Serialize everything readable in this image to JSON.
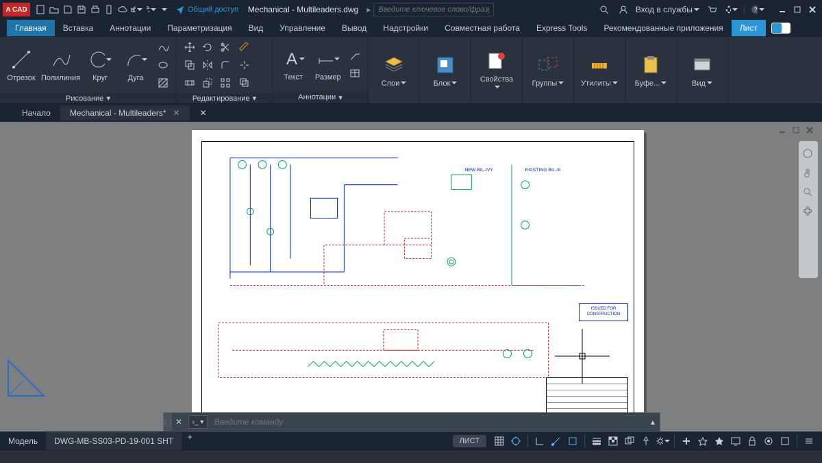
{
  "app": {
    "badge": "A CAD",
    "title": "Mechanical - Multileaders.dwg",
    "share": "Общий доступ"
  },
  "qat_icons": [
    "new",
    "open",
    "save",
    "saveas",
    "plot",
    "mobile",
    "undo",
    "redo"
  ],
  "search": {
    "placeholder": "Введите ключевое слово/фразу"
  },
  "login": "Вход в службы",
  "ribbon_tabs": [
    "Главная",
    "Вставка",
    "Аннотации",
    "Параметризация",
    "Вид",
    "Управление",
    "Вывод",
    "Надстройки",
    "Совместная работа",
    "Express Tools",
    "Рекомендованные приложения",
    "Лист"
  ],
  "ribbon_active": 0,
  "ribbon_accent": 11,
  "panels": {
    "draw": {
      "title": "Рисование",
      "items": [
        "Отрезок",
        "Полилиния",
        "Круг",
        "Дуга"
      ]
    },
    "modify": {
      "title": "Редактирование"
    },
    "annotation": {
      "title": "Аннотации",
      "items": [
        "Текст",
        "Размер"
      ]
    },
    "layers": {
      "title": "Слои",
      "label": "Слои"
    },
    "block": {
      "label": "Блок"
    },
    "properties": {
      "label": "Свойства"
    },
    "groups": {
      "label": "Группы"
    },
    "utilities": {
      "label": "Утилиты"
    },
    "clipboard": {
      "label": "Буфе..."
    },
    "view": {
      "label": "Вид"
    }
  },
  "doc_tabs": {
    "start": "Начало",
    "active": "Mechanical - Multileaders*"
  },
  "drawing": {
    "stamp": "ISSUED FOR\nCONSTRUCTION",
    "new_label": "NEW\nBIL-IVY",
    "existing_label": "EXISTING\nBIL-III"
  },
  "cmd": {
    "placeholder": "Введите команду"
  },
  "status": {
    "model": "Модель",
    "layout": "DWG-MB-SS03-PD-19-001 SHT",
    "badge": "ЛИСТ"
  }
}
